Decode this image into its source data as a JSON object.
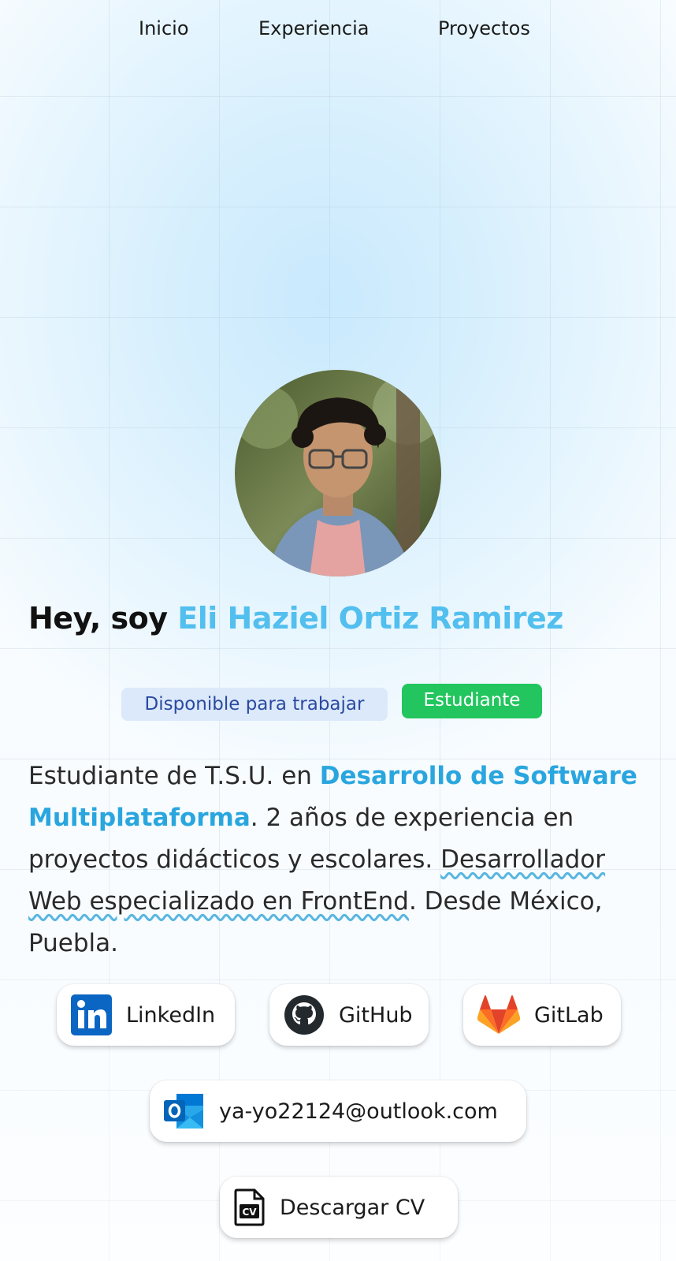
{
  "nav": {
    "items": [
      "Inicio",
      "Experiencia",
      "Proyectos"
    ]
  },
  "hero": {
    "greeting": "Hey, soy",
    "name": "Eli Haziel Ortiz Ramirez",
    "avatar_icon": "profile-photo"
  },
  "badges": {
    "available": "Disponible para trabajar",
    "student": "Estudiante"
  },
  "bio": {
    "part1": "Estudiante de T.S.U. en ",
    "highlight": "Desarrollo de Software Multiplataforma",
    "part2": ". 2 años de experiencia en proyectos didácticos y escolares. ",
    "underlined": "Desarrollador Web especializado en FrontEnd",
    "part3": ". Desde México, Puebla."
  },
  "links": {
    "linkedin": "LinkedIn",
    "github": "GitHub",
    "gitlab": "GitLab",
    "email": "ya-yo22124@outlook.com",
    "cv": "Descargar CV"
  },
  "colors": {
    "accent": "#52bfee",
    "student_badge": "#22c55e",
    "available_badge_bg": "#dbe9fb",
    "available_badge_text": "#2b4aa0"
  }
}
